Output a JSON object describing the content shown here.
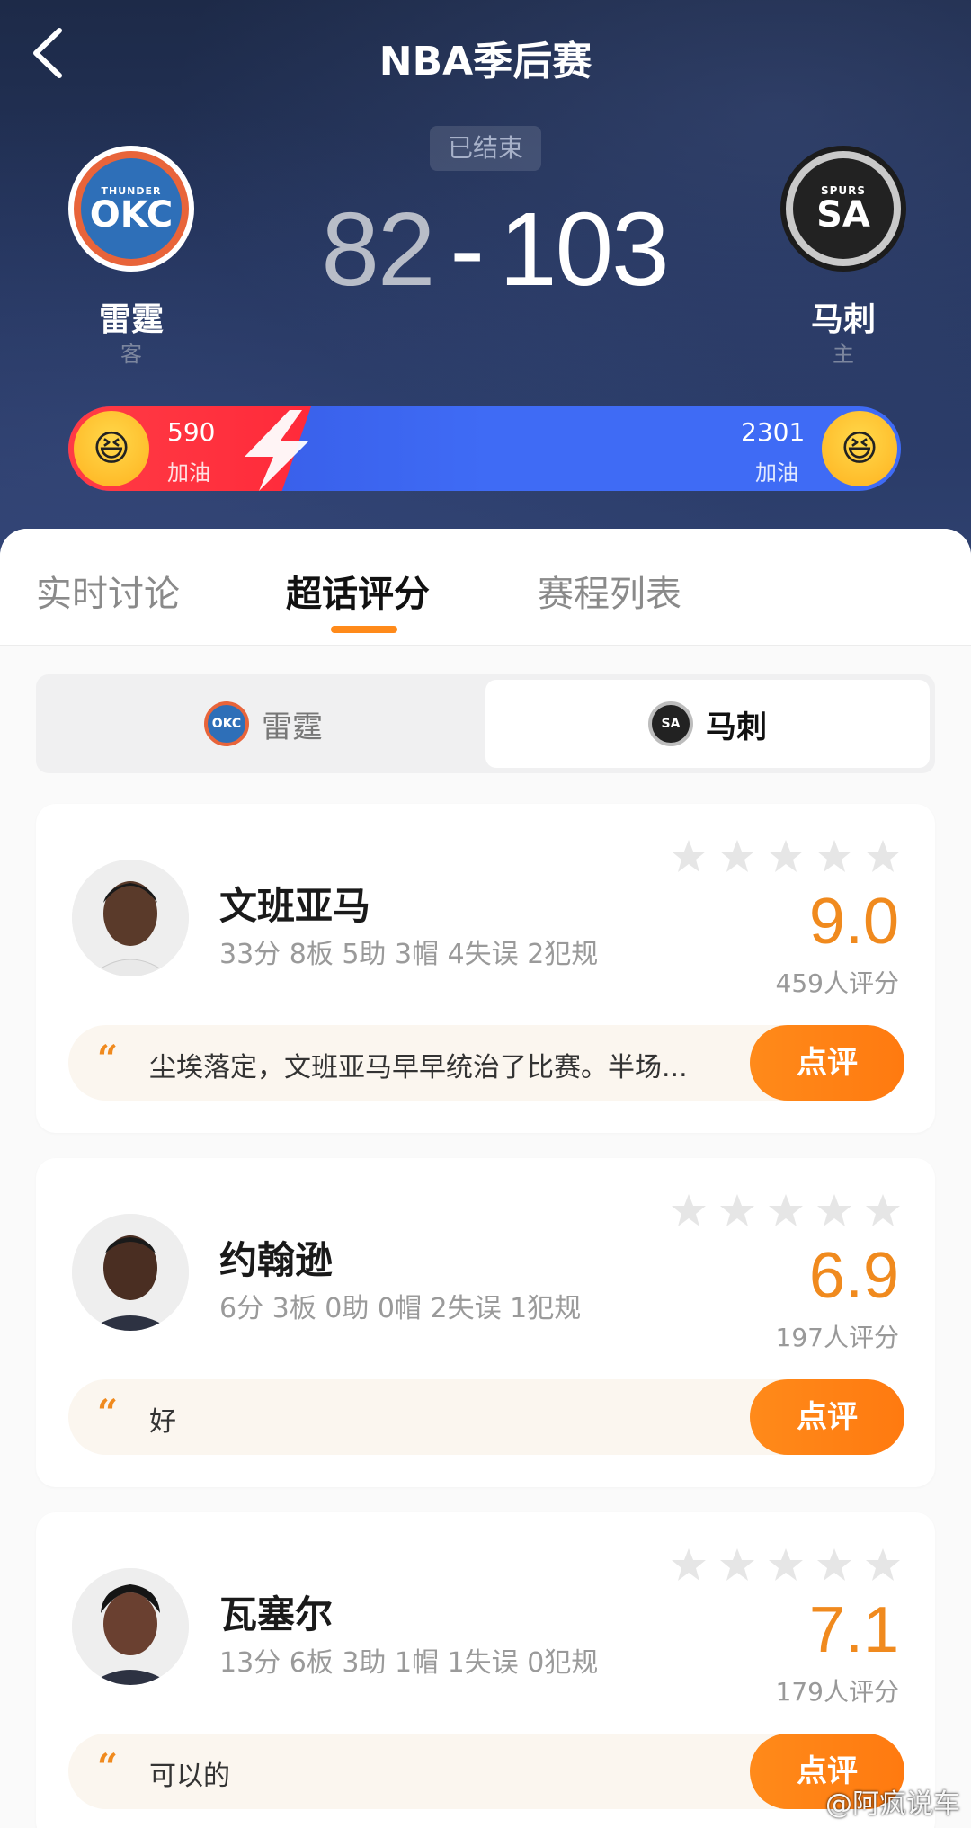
{
  "header": {
    "title": "NBA季后赛",
    "status": "已结束",
    "score_away": "82",
    "score_sep": "-",
    "score_home": "103",
    "away_team": {
      "name": "雷霆",
      "role": "客",
      "logo_small": "THUNDER",
      "logo_big": "OKC",
      "color": "#2e6fb8"
    },
    "home_team": {
      "name": "马刺",
      "role": "主",
      "logo_small": "SPURS",
      "logo_big": "SA",
      "color": "#222222"
    }
  },
  "cheer": {
    "away_count": "590",
    "away_label": "加油",
    "home_count": "2301",
    "home_label": "加油",
    "away_color": "#ff2a3a",
    "home_color": "#3f6bf5"
  },
  "tabs": [
    "实时讨论",
    "超话评分",
    "赛程列表"
  ],
  "segment": {
    "left": "雷霆",
    "right": "马刺",
    "left_mini": "OKC",
    "right_mini": "SA"
  },
  "players": [
    {
      "name": "文班亚马",
      "stats": "33分 8板 5助 3帽 4失误 2犯规",
      "rating": "9.0",
      "count": "459人评分",
      "comment": "尘埃落定，文班亚马早早统治了比赛。半场...",
      "button": "点评"
    },
    {
      "name": "约翰逊",
      "stats": "6分 3板 0助 0帽 2失误 1犯规",
      "rating": "6.9",
      "count": "197人评分",
      "comment": "好",
      "button": "点评"
    },
    {
      "name": "瓦塞尔",
      "stats": "13分 6板 3助 1帽 1失误 0犯规",
      "rating": "7.1",
      "count": "179人评分",
      "comment": "可以的",
      "button": "点评"
    }
  ],
  "watermark": "@阿疯说车",
  "accent": "#f08a1e"
}
